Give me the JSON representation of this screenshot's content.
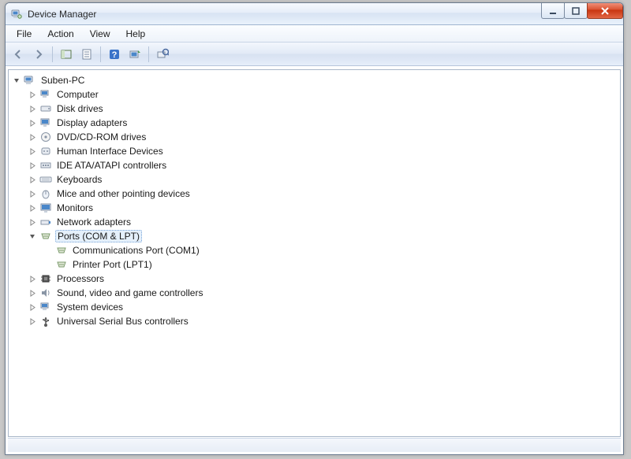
{
  "window": {
    "title": "Device Manager"
  },
  "menu": {
    "file": "File",
    "action": "Action",
    "view": "View",
    "help": "Help"
  },
  "tree": {
    "root": "Suben-PC",
    "computer": "Computer",
    "disk_drives": "Disk drives",
    "display_adapters": "Display adapters",
    "dvd_cd": "DVD/CD-ROM drives",
    "hid": "Human Interface Devices",
    "ide": "IDE ATA/ATAPI controllers",
    "keyboards": "Keyboards",
    "mice": "Mice and other pointing devices",
    "monitors": "Monitors",
    "network": "Network adapters",
    "ports": "Ports (COM & LPT)",
    "ports_com1": "Communications Port (COM1)",
    "ports_lpt1": "Printer Port (LPT1)",
    "processors": "Processors",
    "sound": "Sound, video and game controllers",
    "system": "System devices",
    "usb": "Universal Serial Bus controllers"
  }
}
